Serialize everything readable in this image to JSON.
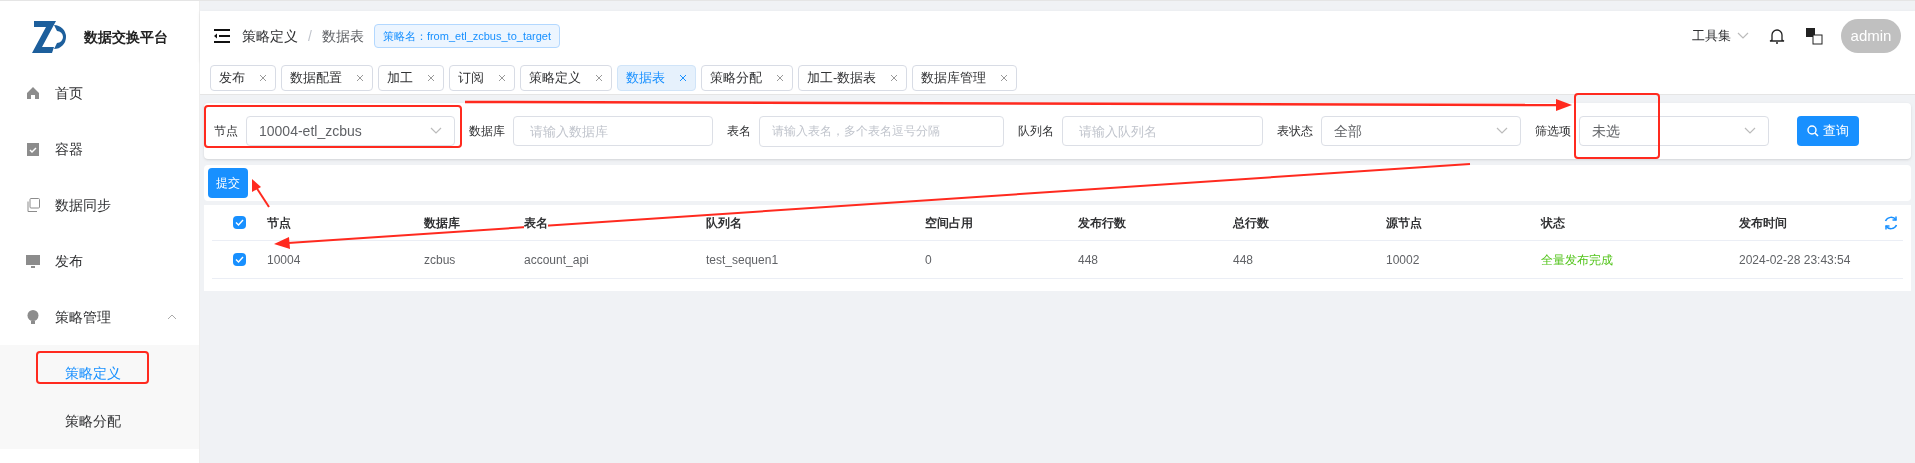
{
  "sidebar": {
    "app_name": "数据交换平台",
    "items": [
      {
        "label": "首页"
      },
      {
        "label": "容器"
      },
      {
        "label": "数据同步"
      },
      {
        "label": "发布"
      },
      {
        "label": "策略管理",
        "expanded": true,
        "children": [
          {
            "label": "策略定义",
            "selected": true
          },
          {
            "label": "策略分配",
            "selected": false
          }
        ]
      }
    ]
  },
  "header": {
    "breadcrumb": [
      "策略定义",
      "数据表"
    ],
    "separator": "/",
    "badge": "策略名：from_etl_zcbus_to_target",
    "tools": "工具集",
    "user": "admin"
  },
  "tabs": [
    {
      "label": "发布",
      "selected": false
    },
    {
      "label": "数据配置",
      "selected": false
    },
    {
      "label": "加工",
      "selected": false
    },
    {
      "label": "订阅",
      "selected": false
    },
    {
      "label": "策略定义",
      "selected": false
    },
    {
      "label": "数据表",
      "selected": true
    },
    {
      "label": "策略分配",
      "selected": false
    },
    {
      "label": "加工-数据表",
      "selected": false
    },
    {
      "label": "数据库管理",
      "selected": false
    }
  ],
  "filters": [
    {
      "kind": "select",
      "label": "节点",
      "value": "10004-etl_zcbus"
    },
    {
      "kind": "input",
      "label": "数据库",
      "placeholder": "请输入数据库"
    },
    {
      "kind": "textarea",
      "label": "表名",
      "placeholder": "请输入表名，多个表名逗号分隔"
    },
    {
      "kind": "input",
      "label": "队列名",
      "placeholder": "请输入队列名"
    },
    {
      "kind": "select",
      "label": "表状态",
      "value": "全部"
    },
    {
      "kind": "select",
      "label": "筛选项",
      "value": "未选"
    }
  ],
  "query_button": "查询",
  "submit_button": "提交",
  "table": {
    "all_checked": true,
    "columns": [
      "节点",
      "数据库",
      "表名",
      "队列名",
      "空间占用",
      "发布行数",
      "总行数",
      "源节点",
      "状态",
      "发布时间"
    ],
    "rows": [
      {
        "checked": true,
        "cells": [
          "10004",
          "zcbus",
          "account_api",
          "test_sequen1",
          "0",
          "448",
          "448",
          "10002",
          "全量发布完成",
          "2024-02-28 23:43:54"
        ]
      }
    ]
  }
}
